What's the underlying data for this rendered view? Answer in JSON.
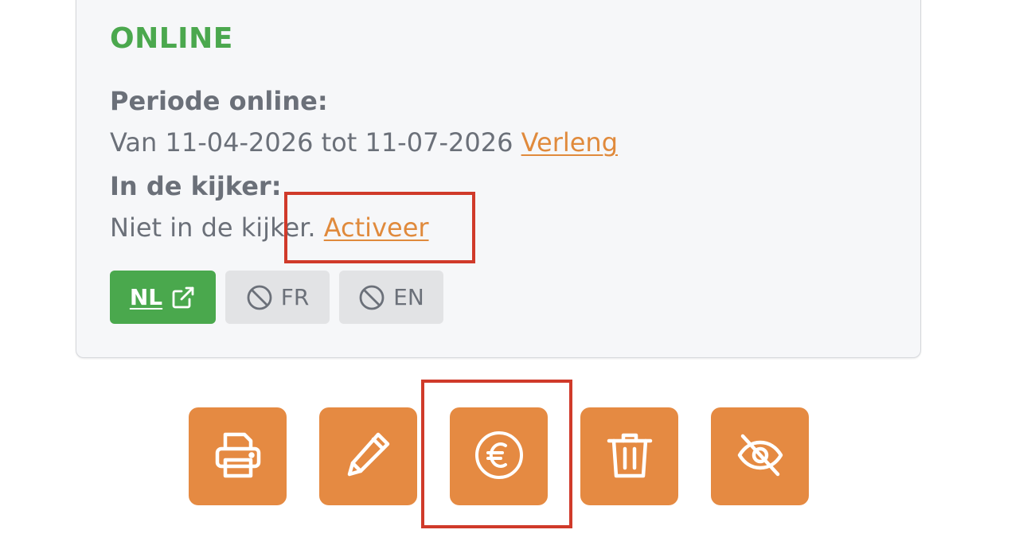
{
  "listing": {
    "status": "ONLINE",
    "period_label": "Periode online:",
    "period_text": "Van 11-04-2026 tot 11-07-2026",
    "extend_link": "Verleng",
    "featured_label": "In de kijker:",
    "featured_text": "Niet in de kijker.",
    "activate_link": "Activeer"
  },
  "languages": [
    {
      "code": "NL",
      "state": "active",
      "icon": "external-link-icon"
    },
    {
      "code": "FR",
      "state": "disabled",
      "icon": "ban-icon"
    },
    {
      "code": "EN",
      "state": "disabled",
      "icon": "ban-icon"
    }
  ],
  "actions": [
    {
      "name": "print",
      "icon": "printer-icon"
    },
    {
      "name": "edit",
      "icon": "pencil-icon"
    },
    {
      "name": "payment",
      "icon": "euro-icon"
    },
    {
      "name": "delete",
      "icon": "trash-icon"
    },
    {
      "name": "hide",
      "icon": "eye-slash-icon"
    }
  ],
  "colors": {
    "status_green": "#4ba84e",
    "accent_orange": "#e58a42",
    "link_orange": "#e08a3c",
    "highlight_red": "#d03a2a"
  }
}
